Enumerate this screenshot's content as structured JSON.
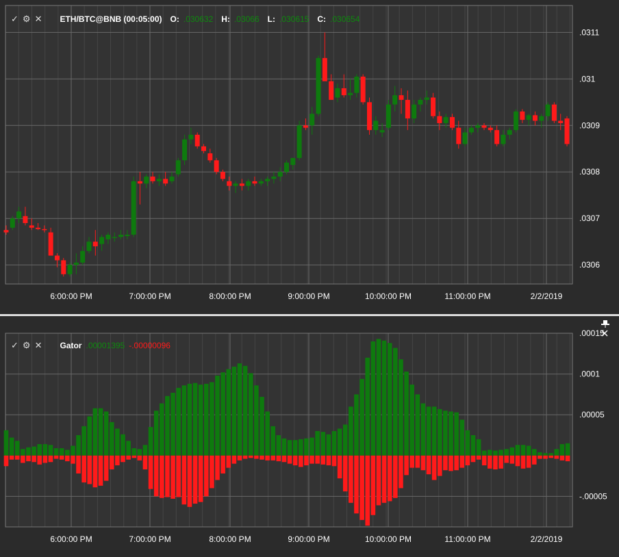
{
  "colors": {
    "up": "#0e7a0e",
    "down": "#ff1a1a",
    "grid": "#6a6a6a",
    "background": "#333333",
    "text": "#ffffff"
  },
  "price_panel": {
    "symbol": "ETH/BTC@BNB (00:05:00)",
    "o_label": "O:",
    "o_value": ".030632",
    "h_label": "H:",
    "h_value": ".03066",
    "l_label": "L:",
    "l_value": ".030615",
    "c_label": "C:",
    "c_value": ".030654",
    "check_icon": "check-icon",
    "gear_icon": "gear-icon",
    "close_icon": "close-icon"
  },
  "gator_panel": {
    "title": "Gator",
    "upper_value": ".00001395",
    "lower_value": "-.00000096",
    "check_icon": "check-icon",
    "gear_icon": "gear-icon",
    "close_icon": "close-icon",
    "pin_icon": "pin-icon"
  },
  "chart_data": [
    {
      "type": "candlestick",
      "title": "ETH/BTC@BNB (00:05:00)",
      "x_ticks": [
        "6:00:00 PM",
        "7:00:00 PM",
        "8:00:00 PM",
        "9:00:00 PM",
        "10:00:00 PM",
        "11:00:00 PM",
        "2/2/2019"
      ],
      "y_ticks": [
        ".0306",
        ".0307",
        ".0308",
        ".0309",
        ".031",
        ".0311"
      ],
      "y_tick_values": [
        0.0306,
        0.0307,
        0.0308,
        0.0309,
        0.031,
        0.0311
      ],
      "ylim": [
        0.030559,
        0.031158
      ],
      "grid": true,
      "note_ohlc": "open, high, low, close per 5-minute bar",
      "candles": [
        [
          0.030675,
          0.030685,
          0.030665,
          0.03067
        ],
        [
          0.03068,
          0.030705,
          0.030675,
          0.0307
        ],
        [
          0.0307,
          0.030725,
          0.03069,
          0.030715
        ],
        [
          0.030705,
          0.030725,
          0.030685,
          0.03069
        ],
        [
          0.030685,
          0.0307,
          0.030675,
          0.03068
        ],
        [
          0.03068,
          0.03069,
          0.030675,
          0.030677
        ],
        [
          0.030677,
          0.030685,
          0.03067,
          0.030675
        ],
        [
          0.03067,
          0.03068,
          0.03062,
          0.03062
        ],
        [
          0.03062,
          0.030625,
          0.030595,
          0.03061
        ],
        [
          0.03061,
          0.030615,
          0.030575,
          0.03058
        ],
        [
          0.03058,
          0.030605,
          0.030575,
          0.0306
        ],
        [
          0.0306,
          0.030625,
          0.03058,
          0.030605
        ],
        [
          0.030605,
          0.03064,
          0.0306,
          0.03063
        ],
        [
          0.03063,
          0.03066,
          0.030625,
          0.03065
        ],
        [
          0.03065,
          0.030675,
          0.03062,
          0.03064
        ],
        [
          0.030645,
          0.030665,
          0.03063,
          0.03066
        ],
        [
          0.030655,
          0.03067,
          0.030645,
          0.030665
        ],
        [
          0.03066,
          0.03067,
          0.03065,
          0.03066
        ],
        [
          0.03066,
          0.030675,
          0.030655,
          0.030665
        ],
        [
          0.030662,
          0.030675,
          0.030655,
          0.030665
        ],
        [
          0.030665,
          0.03079,
          0.03066,
          0.03078
        ],
        [
          0.03078,
          0.0308,
          0.03073,
          0.030775
        ],
        [
          0.030775,
          0.030795,
          0.030765,
          0.03079
        ],
        [
          0.03079,
          0.0308,
          0.030775,
          0.03078
        ],
        [
          0.03078,
          0.030795,
          0.03077,
          0.030785
        ],
        [
          0.030785,
          0.0308,
          0.03077,
          0.030775
        ],
        [
          0.03078,
          0.0308,
          0.030775,
          0.03079
        ],
        [
          0.030795,
          0.03083,
          0.03079,
          0.030825
        ],
        [
          0.030825,
          0.03088,
          0.030815,
          0.03087
        ],
        [
          0.03087,
          0.030895,
          0.03086,
          0.03088
        ],
        [
          0.03088,
          0.030885,
          0.03085,
          0.030855
        ],
        [
          0.030855,
          0.03086,
          0.03084,
          0.030845
        ],
        [
          0.03084,
          0.03085,
          0.03082,
          0.030825
        ],
        [
          0.030825,
          0.03083,
          0.030795,
          0.0308
        ],
        [
          0.0308,
          0.030805,
          0.03078,
          0.030785
        ],
        [
          0.03078,
          0.03079,
          0.03076,
          0.03077
        ],
        [
          0.03077,
          0.03078,
          0.030755,
          0.030775
        ],
        [
          0.030775,
          0.030785,
          0.03076,
          0.03077
        ],
        [
          0.03077,
          0.030785,
          0.03076,
          0.03078
        ],
        [
          0.03078,
          0.03079,
          0.03077,
          0.030775
        ],
        [
          0.030775,
          0.030785,
          0.03077,
          0.03078
        ],
        [
          0.03078,
          0.03079,
          0.03077,
          0.030785
        ],
        [
          0.030785,
          0.0308,
          0.030775,
          0.03079
        ],
        [
          0.03079,
          0.03081,
          0.03078,
          0.0308
        ],
        [
          0.0308,
          0.030825,
          0.030795,
          0.03082
        ],
        [
          0.030815,
          0.03083,
          0.030805,
          0.03083
        ],
        [
          0.03083,
          0.03091,
          0.030825,
          0.0309
        ],
        [
          0.0309,
          0.030915,
          0.03089,
          0.030895
        ],
        [
          0.0309,
          0.03094,
          0.03088,
          0.030925
        ],
        [
          0.030925,
          0.03105,
          0.03092,
          0.031045
        ],
        [
          0.031045,
          0.0311,
          0.03104,
          0.030995
        ],
        [
          0.030995,
          0.03101,
          0.03098,
          0.030955
        ],
        [
          0.03096,
          0.03099,
          0.03095,
          0.03098
        ],
        [
          0.03098,
          0.03101,
          0.03096,
          0.030965
        ],
        [
          0.030965,
          0.031,
          0.030955,
          0.03097
        ],
        [
          0.03097,
          0.03101,
          0.03096,
          0.031005
        ],
        [
          0.031005,
          0.03101,
          0.030945,
          0.03095
        ],
        [
          0.03095,
          0.03096,
          0.03088,
          0.03089
        ],
        [
          0.03089,
          0.03092,
          0.03088,
          0.03091
        ],
        [
          0.030885,
          0.030905,
          0.030875,
          0.03089
        ],
        [
          0.030895,
          0.030955,
          0.03089,
          0.030945
        ],
        [
          0.030945,
          0.030985,
          0.03093,
          0.030965
        ],
        [
          0.030965,
          0.03098,
          0.030925,
          0.030955
        ],
        [
          0.030955,
          0.030975,
          0.03089,
          0.030915
        ],
        [
          0.030915,
          0.030955,
          0.030905,
          0.030945
        ],
        [
          0.030945,
          0.03096,
          0.03093,
          0.030955
        ],
        [
          0.030955,
          0.030975,
          0.030945,
          0.03096
        ],
        [
          0.03096,
          0.03097,
          0.030915,
          0.03092
        ],
        [
          0.03092,
          0.03093,
          0.03089,
          0.030905
        ],
        [
          0.030905,
          0.030925,
          0.030895,
          0.030918
        ],
        [
          0.030918,
          0.030925,
          0.03089,
          0.030895
        ],
        [
          0.030895,
          0.03091,
          0.03085,
          0.03086
        ],
        [
          0.03086,
          0.030895,
          0.030855,
          0.030885
        ],
        [
          0.030885,
          0.0309,
          0.03088,
          0.030895
        ],
        [
          0.030895,
          0.030905,
          0.030885,
          0.0309
        ],
        [
          0.0309,
          0.030905,
          0.03089,
          0.030895
        ],
        [
          0.030895,
          0.0309,
          0.030885,
          0.03089
        ],
        [
          0.03089,
          0.0309,
          0.030855,
          0.03086
        ],
        [
          0.03086,
          0.03089,
          0.030855,
          0.03088
        ],
        [
          0.03088,
          0.030895,
          0.03087,
          0.03089
        ],
        [
          0.03089,
          0.030935,
          0.030885,
          0.03093
        ],
        [
          0.03093,
          0.030935,
          0.030905,
          0.030912
        ],
        [
          0.030912,
          0.030925,
          0.0309,
          0.030922
        ],
        [
          0.030922,
          0.03093,
          0.0309,
          0.03091
        ],
        [
          0.03091,
          0.030925,
          0.030895,
          0.03092
        ],
        [
          0.03092,
          0.03095,
          0.03091,
          0.030945
        ],
        [
          0.030945,
          0.03095,
          0.030905,
          0.03091
        ],
        [
          0.03091,
          0.030925,
          0.03089,
          0.030905
        ],
        [
          0.030915,
          0.03092,
          0.030855,
          0.03086
        ]
      ]
    },
    {
      "type": "bar",
      "title": "Gator",
      "x_ticks": [
        "6:00:00 PM",
        "7:00:00 PM",
        "8:00:00 PM",
        "9:00:00 PM",
        "10:00:00 PM",
        "11:00:00 PM",
        "2/2/2019"
      ],
      "y_ticks": [
        ".00015",
        ".0001",
        ".00005",
        "-.00005"
      ],
      "y_tick_values": [
        0.00015,
        0.0001,
        5e-05,
        -5e-05
      ],
      "ylim": [
        -8.75e-05,
        0.00015
      ],
      "grid": true,
      "upper": [
        3.1e-05,
        2.2e-05,
        1.8e-05,
        8e-06,
        1e-05,
        1.1e-05,
        1.4e-05,
        1.4e-05,
        1.3e-05,
        9e-06,
        9e-06,
        7e-06,
        1.2e-05,
        2.5e-05,
        3.6e-05,
        4.8e-05,
        5.8e-05,
        5.8e-05,
        5.4e-05,
        4.1e-05,
        3.3e-05,
        2.6e-05,
        1.8e-05,
        9e-06,
        8e-06,
        1.3e-05,
        3.5e-05,
        5.5e-05,
        6.4e-05,
        7.3e-05,
        7.7e-05,
        8.3e-05,
        8.6e-05,
        8.8e-05,
        8.9e-05,
        8.7e-05,
        8.8e-05,
        9e-05,
        9.8e-05,
        0.000102,
        0.000106,
        0.000109,
        0.000113,
        0.00011,
        0.000101,
        8.6e-05,
        7.2e-05,
        5.4e-05,
        3.6e-05,
        2.5e-05,
        2.1e-05,
        1.9e-05,
        1.9e-05,
        2e-05,
        2.1e-05,
        2.2e-05,
        3e-05,
        2.9e-05,
        2.6e-05,
        3e-05,
        3.3e-05,
        3.8e-05,
        6e-05,
        7.5e-05,
        9.4e-05,
        0.00012,
        0.00014,
        0.000143,
        0.000141,
        0.000138,
        0.000132,
        0.000118,
        0.000103,
        8.7e-05,
        7.5e-05,
        6.4e-05,
        6e-05,
        6e-05,
        5.7e-05,
        5.5e-05,
        5.4e-05,
        5.3e-05,
        4.4e-05,
        3.1e-05,
        2.5e-05,
        2e-05,
        6e-06,
        7e-06,
        6e-06,
        7e-06,
        8e-06,
        1e-05,
        1.3e-05,
        1.3e-05,
        1.2e-05,
        8e-06,
        4e-06,
        3e-06,
        3e-06,
        8e-06,
        1.4e-05,
        1.5e-05
      ],
      "lower": [
        -1.3e-05,
        -5e-06,
        -5e-06,
        -9e-06,
        -7e-06,
        -8e-06,
        -1.1e-05,
        -9e-06,
        -8e-06,
        -4e-06,
        -5e-06,
        -7e-06,
        -1e-05,
        -2.2e-05,
        -3.3e-05,
        -3.5e-05,
        -3.9e-05,
        -3.7e-05,
        -3.1e-05,
        -1.7e-05,
        -1.2e-05,
        -8e-06,
        -5e-06,
        -3e-06,
        -6e-06,
        -1.7e-05,
        -4.1e-05,
        -5e-05,
        -5.2e-05,
        -5.1e-05,
        -5.3e-05,
        -5.1e-05,
        -6e-05,
        -6.3e-05,
        -5.9e-05,
        -5.7e-05,
        -5e-05,
        -4e-05,
        -3e-05,
        -2.2e-05,
        -1.5e-05,
        -1e-05,
        -6e-06,
        -4e-06,
        -3e-06,
        -4e-06,
        -5e-06,
        -6e-06,
        -6e-06,
        -7e-06,
        -8e-06,
        -1e-05,
        -1.2e-05,
        -1.4e-05,
        -1.2e-05,
        -1e-05,
        -1e-05,
        -1.1e-05,
        -1.2e-05,
        -1.3e-05,
        -2.8e-05,
        -4.4e-05,
        -5.8e-05,
        -7.1e-05,
        -7.9e-05,
        -8.6e-05,
        -7.3e-05,
        -6.1e-05,
        -5.8e-05,
        -5.6e-05,
        -5.2e-05,
        -4e-05,
        -2.4e-05,
        -1.5e-05,
        -1.5e-05,
        -1.8e-05,
        -2.3e-05,
        -3e-05,
        -2.5e-05,
        -1.8e-05,
        -1.9e-05,
        -1.8e-05,
        -1.5e-05,
        -1.2e-05,
        -8e-06,
        -5e-06,
        -1.2e-05,
        -1.6e-05,
        -1.7e-05,
        -1.6e-05,
        -9e-06,
        -1e-05,
        -1.3e-05,
        -1.6e-05,
        -1.5e-05,
        -1.1e-05,
        -4e-06,
        -4e-06,
        -3e-06,
        -4e-06,
        -6e-06,
        -7e-06
      ]
    }
  ]
}
